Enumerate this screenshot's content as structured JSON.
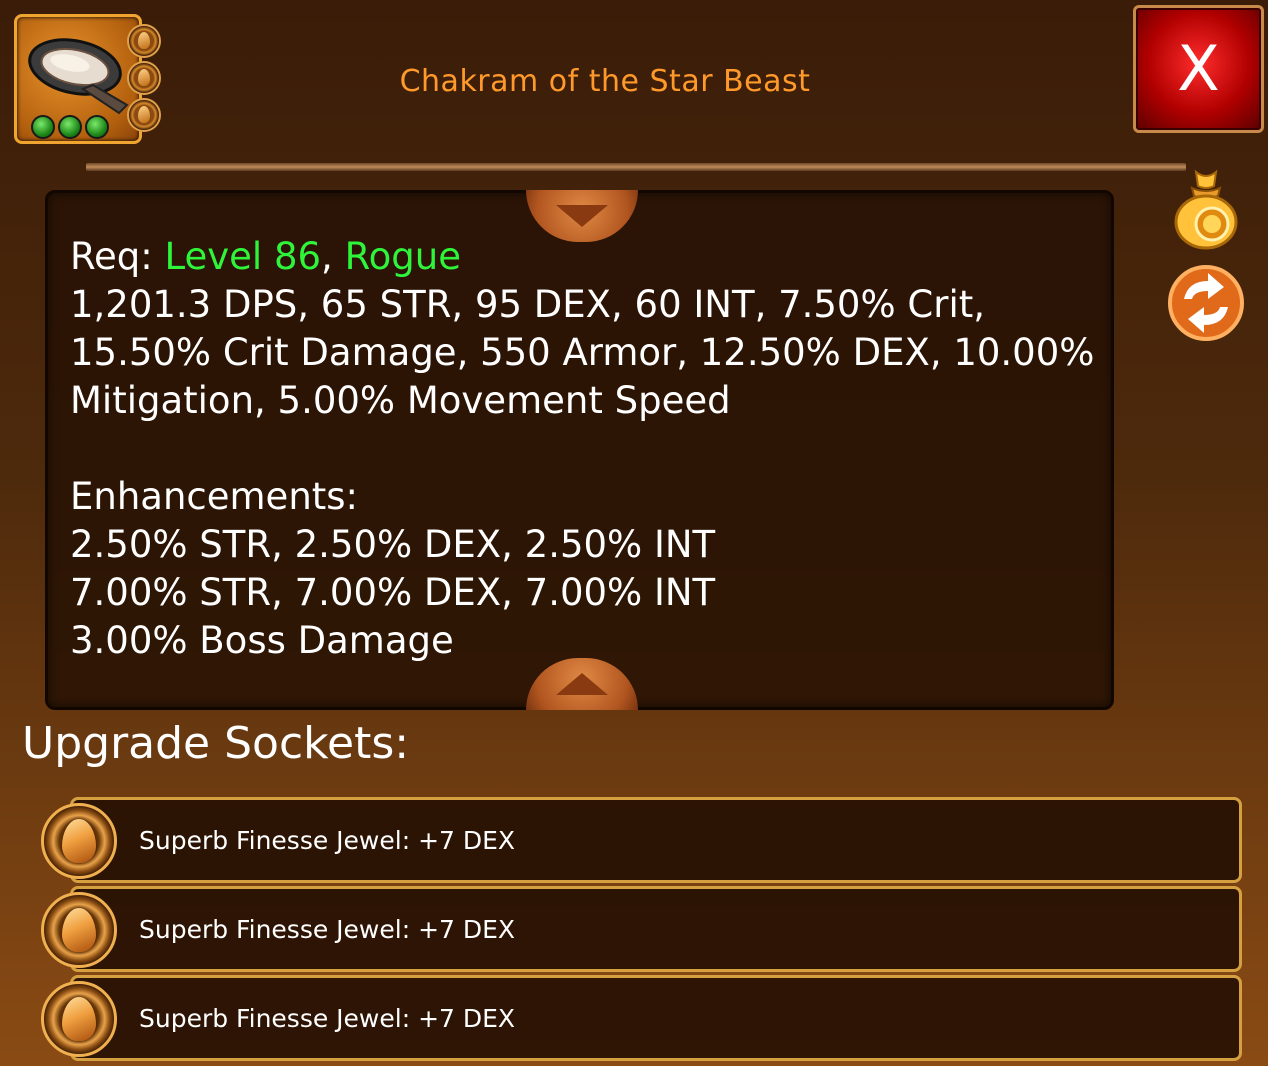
{
  "item": {
    "name": "Chakram of the Star Beast",
    "icon": "chakram-icon",
    "gem_slots": 3,
    "sockets_mini": 3
  },
  "close_button": {
    "label": "X"
  },
  "stats": {
    "req_label": "Req: ",
    "req_level": "Level 86",
    "req_sep": ", ",
    "req_class": "Rogue",
    "line_1": "1,201.3 DPS, 65 STR, 95 DEX, 60 INT, 7.50% Crit,",
    "line_2": "15.50% Crit Damage, 550 Armor, 12.50% DEX, 10.00%",
    "line_3": "Mitigation, 5.00% Movement Speed",
    "enhancements_label": "Enhancements:",
    "enh_1": "2.50% STR, 2.50% DEX, 2.50% INT",
    "enh_2": "7.00% STR, 7.00% DEX, 7.00% INT",
    "enh_3": "3.00% Boss Damage"
  },
  "side_icons": [
    "gold-bag-icon",
    "swap-arrows-icon"
  ],
  "upgrade_sockets": {
    "heading": "Upgrade Sockets:",
    "items": [
      {
        "label": "Superb Finesse Jewel: +7 DEX"
      },
      {
        "label": "Superb Finesse Jewel: +7 DEX"
      },
      {
        "label": "Superb Finesse Jewel: +7 DEX"
      }
    ]
  },
  "colors": {
    "title": "#ff9a2a",
    "requirement": "#2ef53a",
    "close": "#c00000",
    "socket_border": "#d6a040"
  }
}
